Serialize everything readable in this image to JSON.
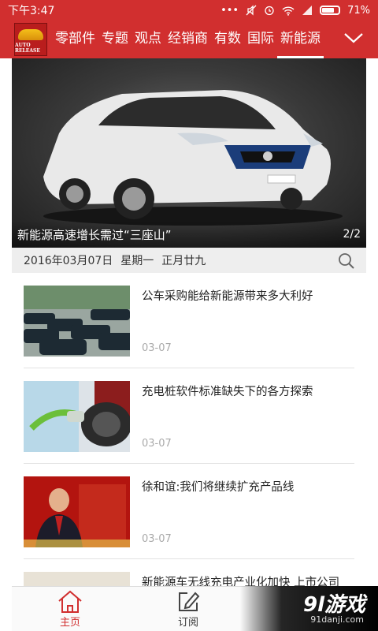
{
  "status_bar": {
    "time": "下午3:47",
    "battery": "71%"
  },
  "header": {
    "logo_text": "AUTO RELEASE",
    "tabs": [
      "零部件",
      "专题",
      "观点",
      "经销商",
      "有数",
      "国际",
      "新能源"
    ],
    "active_tab": "新能源"
  },
  "banner": {
    "title": "新能源高速增长需过“三座山”",
    "pager": "2/2"
  },
  "date_bar": {
    "date": "2016年03月07日",
    "weekday": "星期一",
    "lunar": "正月廿九"
  },
  "news": [
    {
      "title": "公车采购能给新能源带来多大利好",
      "date": "03-07"
    },
    {
      "title": "充电桩软件标准缺失下的各方探索",
      "date": "03-07"
    },
    {
      "title": "徐和谊:我们将继续扩充产品线",
      "date": "03-07"
    },
    {
      "title": "新能源车无线充电产业化加快 上市公司"
    }
  ],
  "bottom_nav": {
    "home": "主页",
    "subscribe": "订阅"
  },
  "watermark": {
    "brand": "9l游戏",
    "site": "91danji.com"
  },
  "colors": {
    "brand_red": "#d12f2f"
  }
}
